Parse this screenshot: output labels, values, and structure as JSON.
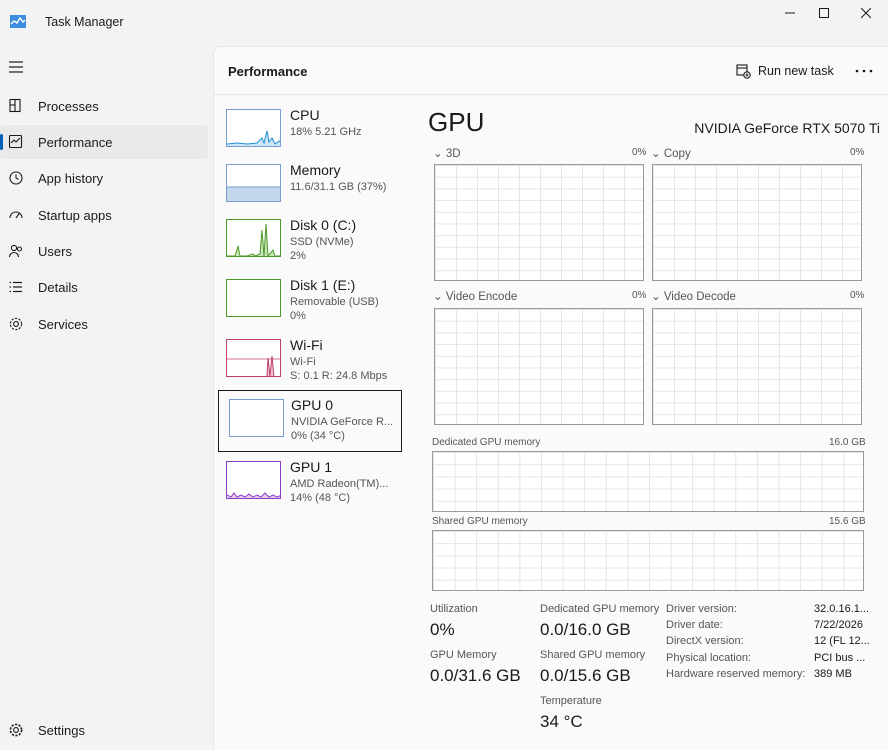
{
  "window": {
    "title": "Task Manager"
  },
  "nav": {
    "items": [
      {
        "label": "Processes",
        "icon": "processes-icon"
      },
      {
        "label": "Performance",
        "icon": "performance-icon"
      },
      {
        "label": "App history",
        "icon": "history-icon"
      },
      {
        "label": "Startup apps",
        "icon": "startup-icon"
      },
      {
        "label": "Users",
        "icon": "users-icon"
      },
      {
        "label": "Details",
        "icon": "details-icon"
      },
      {
        "label": "Services",
        "icon": "services-icon"
      }
    ],
    "settings": "Settings"
  },
  "header": {
    "title": "Performance",
    "run_task": "Run new task"
  },
  "devices": [
    {
      "name": "CPU",
      "sub1": "18%  5.21 GHz",
      "sub2": "",
      "color": "#1f8fd1"
    },
    {
      "name": "Memory",
      "sub1": "11.6/31.1 GB (37%)",
      "sub2": "",
      "color": "#7a9ecb"
    },
    {
      "name": "Disk 0 (C:)",
      "sub1": "SSD (NVMe)",
      "sub2": "2%",
      "color": "#4c9a2a"
    },
    {
      "name": "Disk 1 (E:)",
      "sub1": "Removable (USB)",
      "sub2": "0%",
      "color": "#4c9a2a"
    },
    {
      "name": "Wi-Fi",
      "sub1": "Wi-Fi",
      "sub2": "S: 0.1  R: 24.8 Mbps",
      "color": "#c1406b"
    },
    {
      "name": "GPU 0",
      "sub1": "NVIDIA GeForce R...",
      "sub2": "0%  (34 °C)",
      "color": "#7a9ecb"
    },
    {
      "name": "GPU 1",
      "sub1": "AMD Radeon(TM)...",
      "sub2": "14%  (48 °C)",
      "color": "#8a3fc7"
    }
  ],
  "gpu": {
    "heading": "GPU",
    "model": "NVIDIA GeForce RTX 5070 Ti",
    "engines": [
      {
        "label": "3D",
        "pct": "0%"
      },
      {
        "label": "Copy",
        "pct": "0%"
      },
      {
        "label": "Video Encode",
        "pct": "0%"
      },
      {
        "label": "Video Decode",
        "pct": "0%"
      }
    ],
    "dedicated_label": "Dedicated GPU memory",
    "dedicated_max": "16.0 GB",
    "shared_label": "Shared GPU memory",
    "shared_max": "15.6 GB",
    "stats": {
      "utilization_label": "Utilization",
      "utilization": "0%",
      "dedicated_label": "Dedicated GPU memory",
      "dedicated": "0.0/16.0 GB",
      "gpumem_label": "GPU Memory",
      "gpumem": "0.0/31.6 GB",
      "shared_label": "Shared GPU memory",
      "shared": "0.0/15.6 GB",
      "temp_label": "Temperature",
      "temp": "34 °C"
    },
    "info": [
      {
        "k": "Driver version:",
        "v": "32.0.16.1..."
      },
      {
        "k": "Driver date:",
        "v": "7/22/2026"
      },
      {
        "k": "DirectX version:",
        "v": "12 (FL 12..."
      },
      {
        "k": "Physical location:",
        "v": "PCI bus ..."
      },
      {
        "k": "Hardware reserved memory:",
        "v": "389 MB"
      }
    ]
  },
  "colors": {
    "accent": "#005fb8",
    "graph_border": "#9a9a9a"
  }
}
